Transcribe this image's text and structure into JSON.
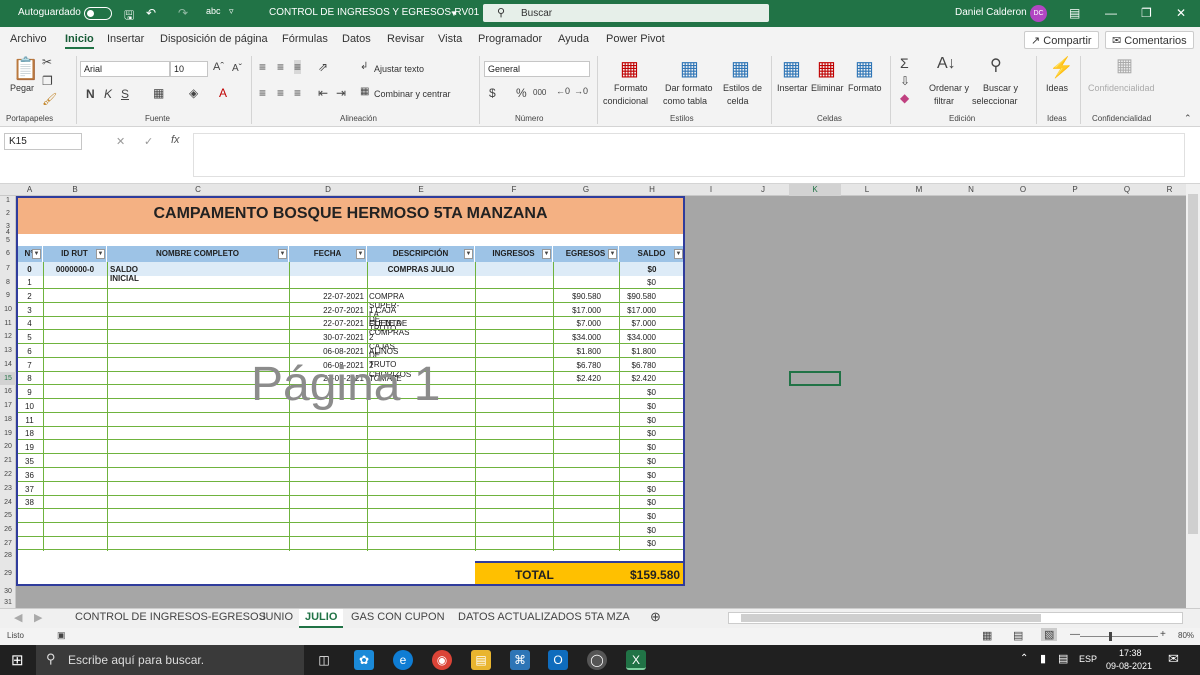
{
  "titlebar": {
    "autosave": "Autoguardado",
    "filename": "CONTROL DE INGRESOS Y EGRESOS-RV01",
    "search": "Buscar",
    "user": "Daniel Calderon",
    "user_initials": "DC",
    "accent": "#217346"
  },
  "menu": {
    "items": [
      "Archivo",
      "Inicio",
      "Insertar",
      "Disposición de página",
      "Fórmulas",
      "Datos",
      "Revisar",
      "Vista",
      "Programador",
      "Ayuda",
      "Power Pivot"
    ],
    "share": "Compartir",
    "comments": "Comentarios"
  },
  "ribbon": {
    "paste": "Pegar",
    "font_name": "Arial",
    "font_size": "10",
    "bold": "N",
    "italic": "K",
    "underline": "S",
    "wrap": "Ajustar texto",
    "merge": "Combinar y centrar",
    "number_format": "General",
    "pct": "%",
    "thousands": "000",
    "cond_fmt": [
      "Formato",
      "condicional"
    ],
    "table_fmt": [
      "Dar formato",
      "como tabla"
    ],
    "cell_styles": [
      "Estilos de",
      "celda"
    ],
    "insert": "Insertar",
    "delete": "Eliminar",
    "format": "Formato",
    "sort": [
      "Ordenar y",
      "filtrar"
    ],
    "find": [
      "Buscar y",
      "seleccionar"
    ],
    "ideas": "Ideas",
    "confidential": "Confidencialidad",
    "groups": [
      "Portapapeles",
      "Fuente",
      "Alineación",
      "Número",
      "Estilos",
      "Celdas",
      "Edición",
      "Ideas",
      "Confidencialidad"
    ]
  },
  "formula": {
    "namebox": "K15",
    "fx": "fx",
    "content": ""
  },
  "columns": [
    "A",
    "B",
    "C",
    "D",
    "E",
    "F",
    "G",
    "H",
    "I",
    "J",
    "K",
    "L",
    "M",
    "N",
    "O",
    "P",
    "Q",
    "R"
  ],
  "rows": [
    "1",
    "2",
    "3",
    "4",
    "5",
    "6",
    "7",
    "8",
    "9",
    "10",
    "11",
    "12",
    "13",
    "14",
    "15",
    "16",
    "17",
    "18",
    "19",
    "20",
    "21",
    "22",
    "23",
    "24",
    "25",
    "26",
    "27",
    "28",
    "29",
    "30",
    "31"
  ],
  "sheet": {
    "title": "CAMPAMENTO BOSQUE HERMOSO 5TA MANZANA",
    "headers": [
      "N°",
      "ID RUT",
      "NOMBRE COMPLETO",
      "FECHA",
      "DESCRIPCIÓN",
      "INGRESOS",
      "EGRESOS",
      "SALDO"
    ],
    "row0": {
      "n": "0",
      "rut": "0000000-0",
      "name": "SALDO INICIAL",
      "desc": "COMPRAS JULIO",
      "saldo": "$0"
    },
    "data": [
      {
        "n": "1",
        "fecha": "",
        "desc": "",
        "egresos": "",
        "saldo": "$0"
      },
      {
        "n": "2",
        "fecha": "22-07-2021",
        "desc": "COMPRA SUPER-LA CUENTA",
        "egresos": "$90.580",
        "saldo": "$90.580"
      },
      {
        "n": "3",
        "fecha": "22-07-2021",
        "desc": "1 CAJA DE TRUTO",
        "egresos": "$17.000",
        "saldo": "$17.000"
      },
      {
        "n": "4",
        "fecha": "22-07-2021",
        "desc": "FLETE DE COMPRAS",
        "egresos": "$7.000",
        "saldo": "$7.000"
      },
      {
        "n": "5",
        "fecha": "30-07-2021",
        "desc": "2 CAJAS DE TRUTO",
        "egresos": "$34.000",
        "saldo": "$34.000"
      },
      {
        "n": "6",
        "fecha": "06-08-2021",
        "desc": "ALIÑOS",
        "egresos": "$1.800",
        "saldo": "$1.800"
      },
      {
        "n": "7",
        "fecha": "06-08-2021",
        "desc": "2 CHORIZOS",
        "egresos": "$6.780",
        "saldo": "$6.780"
      },
      {
        "n": "8",
        "fecha": "27-07-2021",
        "desc": "TOMATE",
        "egresos": "$2.420",
        "saldo": "$2.420"
      },
      {
        "n": "9",
        "fecha": "",
        "desc": "",
        "egresos": "",
        "saldo": "$0"
      },
      {
        "n": "10",
        "fecha": "",
        "desc": "",
        "egresos": "",
        "saldo": "$0"
      },
      {
        "n": "11",
        "fecha": "",
        "desc": "",
        "egresos": "",
        "saldo": "$0"
      },
      {
        "n": "18",
        "fecha": "",
        "desc": "",
        "egresos": "",
        "saldo": "$0"
      },
      {
        "n": "19",
        "fecha": "",
        "desc": "",
        "egresos": "",
        "saldo": "$0"
      },
      {
        "n": "35",
        "fecha": "",
        "desc": "",
        "egresos": "",
        "saldo": "$0"
      },
      {
        "n": "36",
        "fecha": "",
        "desc": "",
        "egresos": "",
        "saldo": "$0"
      },
      {
        "n": "37",
        "fecha": "",
        "desc": "",
        "egresos": "",
        "saldo": "$0"
      },
      {
        "n": "38",
        "fecha": "",
        "desc": "",
        "egresos": "",
        "saldo": "$0"
      },
      {
        "n": "",
        "fecha": "",
        "desc": "",
        "egresos": "",
        "saldo": "$0"
      },
      {
        "n": "",
        "fecha": "",
        "desc": "",
        "egresos": "",
        "saldo": "$0"
      },
      {
        "n": "",
        "fecha": "",
        "desc": "",
        "egresos": "",
        "saldo": "$0"
      }
    ],
    "total_label": "TOTAL",
    "total_value": "$159.580",
    "page_label": "Página 1",
    "title_color": "#f4b183",
    "header_color": "#9dc3e6",
    "total_color": "#ffc000"
  },
  "tabs": [
    "CONTROL DE INGRESOS-EGRESOS",
    "JUNIO",
    "JULIO",
    "GAS CON CUPON",
    "DATOS ACTUALIZADOS 5TA MZA"
  ],
  "active_tab": "JULIO",
  "status": {
    "ready": "Listo",
    "zoom": "80%"
  },
  "taskbar": {
    "search": "Escribe aquí para buscar.",
    "lang": "ESP",
    "time": "17:38",
    "date": "09-08-2021"
  }
}
